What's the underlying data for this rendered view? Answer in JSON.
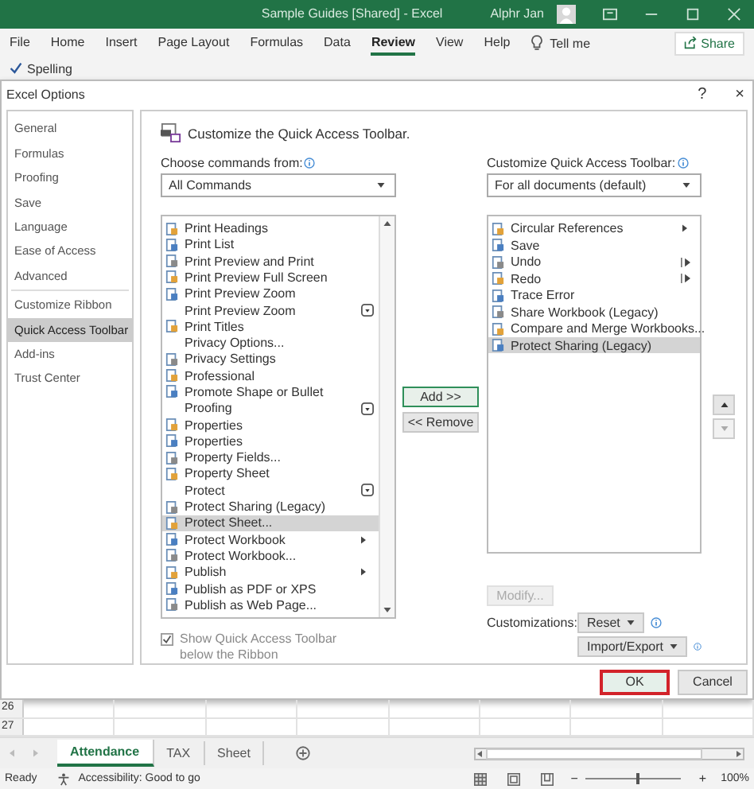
{
  "app": {
    "title": "Sample Guides [Shared] - Excel",
    "user": "Alphr Jan"
  },
  "ribbon_tabs": [
    {
      "label": "File",
      "selected": false
    },
    {
      "label": "Home",
      "selected": false
    },
    {
      "label": "Insert",
      "selected": false
    },
    {
      "label": "Page Layout",
      "selected": false
    },
    {
      "label": "Formulas",
      "selected": false
    },
    {
      "label": "Data",
      "selected": false
    },
    {
      "label": "Review",
      "selected": true
    },
    {
      "label": "View",
      "selected": false
    },
    {
      "label": "Help",
      "selected": false
    }
  ],
  "tell_me": "Tell me",
  "share": "Share",
  "ribbon": {
    "spelling": "Spelling"
  },
  "dialog": {
    "title": "Excel Options",
    "help": "?",
    "close": "×",
    "nav": [
      {
        "label": "General",
        "selected": false,
        "group_end": false
      },
      {
        "label": "Formulas",
        "selected": false,
        "group_end": false
      },
      {
        "label": "Proofing",
        "selected": false,
        "group_end": false
      },
      {
        "label": "Save",
        "selected": false,
        "group_end": false
      },
      {
        "label": "Language",
        "selected": false,
        "group_end": false
      },
      {
        "label": "Ease of Access",
        "selected": false,
        "group_end": false
      },
      {
        "label": "Advanced",
        "selected": false,
        "group_end": true
      },
      {
        "label": "Customize Ribbon",
        "selected": false,
        "group_end": false
      },
      {
        "label": "Quick Access Toolbar",
        "selected": true,
        "group_end": false
      },
      {
        "label": "Add-ins",
        "selected": false,
        "group_end": false
      },
      {
        "label": "Trust Center",
        "selected": false,
        "group_end": false
      }
    ],
    "heading": "Customize the Quick Access Toolbar.",
    "left": {
      "label": "Choose commands from:",
      "dropdown": "All Commands",
      "commands": [
        {
          "label": "Print Headings",
          "selected": false,
          "has_icon": true,
          "kind": "plain"
        },
        {
          "label": "Print List",
          "selected": false,
          "has_icon": true,
          "kind": "plain"
        },
        {
          "label": "Print Preview and Print",
          "selected": false,
          "has_icon": true,
          "kind": "plain"
        },
        {
          "label": "Print Preview Full Screen",
          "selected": false,
          "has_icon": true,
          "kind": "plain"
        },
        {
          "label": "Print Preview Zoom",
          "selected": false,
          "has_icon": true,
          "kind": "plain"
        },
        {
          "label": "Print Preview Zoom",
          "selected": false,
          "has_icon": false,
          "kind": "gallery"
        },
        {
          "label": "Print Titles",
          "selected": false,
          "has_icon": true,
          "kind": "plain"
        },
        {
          "label": "Privacy Options...",
          "selected": false,
          "has_icon": false,
          "kind": "plain"
        },
        {
          "label": "Privacy Settings",
          "selected": false,
          "has_icon": true,
          "kind": "plain"
        },
        {
          "label": "Professional",
          "selected": false,
          "has_icon": true,
          "kind": "plain"
        },
        {
          "label": "Promote Shape or Bullet",
          "selected": false,
          "has_icon": true,
          "kind": "plain"
        },
        {
          "label": "Proofing",
          "selected": false,
          "has_icon": false,
          "kind": "gallery"
        },
        {
          "label": "Properties",
          "selected": false,
          "has_icon": true,
          "kind": "plain"
        },
        {
          "label": "Properties",
          "selected": false,
          "has_icon": true,
          "kind": "plain"
        },
        {
          "label": "Property Fields...",
          "selected": false,
          "has_icon": true,
          "kind": "plain"
        },
        {
          "label": "Property Sheet",
          "selected": false,
          "has_icon": true,
          "kind": "plain"
        },
        {
          "label": "Protect",
          "selected": false,
          "has_icon": false,
          "kind": "gallery"
        },
        {
          "label": "Protect Sharing (Legacy)",
          "selected": false,
          "has_icon": true,
          "kind": "plain"
        },
        {
          "label": "Protect Sheet...",
          "selected": true,
          "has_icon": true,
          "kind": "plain"
        },
        {
          "label": "Protect Workbook",
          "selected": false,
          "has_icon": true,
          "kind": "submenu"
        },
        {
          "label": "Protect Workbook...",
          "selected": false,
          "has_icon": true,
          "kind": "plain"
        },
        {
          "label": "Publish",
          "selected": false,
          "has_icon": true,
          "kind": "submenu"
        },
        {
          "label": "Publish as PDF or XPS",
          "selected": false,
          "has_icon": true,
          "kind": "plain"
        },
        {
          "label": "Publish as Web Page...",
          "selected": false,
          "has_icon": true,
          "kind": "plain"
        }
      ]
    },
    "add": "Add >>",
    "remove": "<< Remove",
    "right": {
      "label": "Customize Quick Access Toolbar:",
      "dropdown": "For all documents (default)",
      "items": [
        {
          "label": "Circular References",
          "selected": false,
          "kind": "submenu"
        },
        {
          "label": "Save",
          "selected": false,
          "kind": "plain"
        },
        {
          "label": "Undo",
          "selected": false,
          "kind": "split"
        },
        {
          "label": "Redo",
          "selected": false,
          "kind": "split"
        },
        {
          "label": "Trace Error",
          "selected": false,
          "kind": "plain"
        },
        {
          "label": "Share Workbook (Legacy)",
          "selected": false,
          "kind": "plain"
        },
        {
          "label": "Compare and Merge Workbooks...",
          "selected": false,
          "kind": "plain"
        },
        {
          "label": "Protect Sharing (Legacy)",
          "selected": true,
          "kind": "plain"
        }
      ]
    },
    "move_up": {
      "disabled": false
    },
    "move_down": {
      "disabled": true
    },
    "show_below": {
      "label": "Show Quick Access Toolbar below the Ribbon",
      "checked": true,
      "disabled": true
    },
    "modify": {
      "label": "Modify...",
      "disabled": true
    },
    "customizations": "Customizations:",
    "reset": "Reset",
    "import_export": "Import/Export",
    "ok": {
      "label": "OK",
      "highlighted": true
    },
    "cancel": {
      "label": "Cancel",
      "highlighted": false
    }
  },
  "sheet": {
    "rows": [
      "26",
      "27"
    ],
    "tabs": [
      {
        "label": "Attendance",
        "selected": true
      },
      {
        "label": "TAX",
        "selected": false
      },
      {
        "label": "Sheet",
        "selected": false
      }
    ]
  },
  "status": {
    "ready": "Ready",
    "accessibility": "Accessibility: Good to go",
    "zoom_out": "−",
    "zoom_in": "+",
    "zoom": {
      "level": 0.55
    },
    "zoom_text": "100%"
  }
}
